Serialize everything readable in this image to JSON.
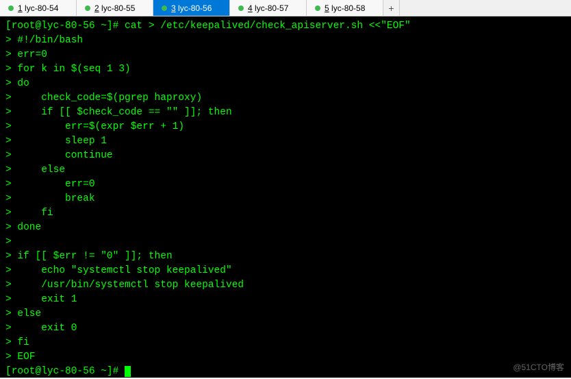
{
  "tabs": [
    {
      "num": "1",
      "label": "lyc-80-54",
      "active": false
    },
    {
      "num": "2",
      "label": "lyc-80-55",
      "active": false
    },
    {
      "num": "3",
      "label": "lyc-80-56",
      "active": true
    },
    {
      "num": "4",
      "label": "lyc-80-57",
      "active": false
    },
    {
      "num": "5",
      "label": "lyc-80-58",
      "active": false
    }
  ],
  "add_tab": "+",
  "terminal": {
    "prompt1": "[root@lyc-80-56 ~]# ",
    "cmd1": "cat > /etc/keepalived/check_apiserver.sh <<\"EOF\"",
    "lines": [
      "> #!/bin/bash",
      "> err=0",
      "> for k in $(seq 1 3)",
      "> do",
      ">     check_code=$(pgrep haproxy)",
      ">     if [[ $check_code == \"\" ]]; then",
      ">         err=$(expr $err + 1)",
      ">         sleep 1",
      ">         continue",
      ">     else",
      ">         err=0",
      ">         break",
      ">     fi",
      "> done",
      "> ",
      "> if [[ $err != \"0\" ]]; then",
      ">     echo \"systemctl stop keepalived\"",
      ">     /usr/bin/systemctl stop keepalived",
      ">     exit 1",
      "> else",
      ">     exit 0",
      "> fi",
      "> EOF"
    ],
    "prompt2": "[root@lyc-80-56 ~]# "
  },
  "watermark": "@51CTO博客"
}
